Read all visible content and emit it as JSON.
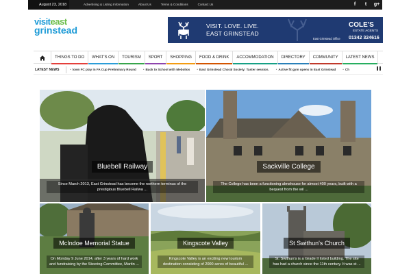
{
  "topbar": {
    "date": "August 23, 2018",
    "links": [
      "Advertising & Listing Information",
      "About Us",
      "Terms & Conditions",
      "Contact Us"
    ],
    "social": [
      {
        "icon": "facebook-icon",
        "glyph": "f"
      },
      {
        "icon": "twitter-icon",
        "glyph": "t"
      },
      {
        "icon": "googleplus-icon",
        "glyph": "g+"
      }
    ]
  },
  "logo": {
    "line1a": "visit",
    "line1b": "east",
    "line2": "grinstead"
  },
  "ad": {
    "line1": "VISIT.   LOVE.   LIVE.",
    "line2": "EAST GRINSTEAD",
    "brand": "COLE'S",
    "brand_sub": "ESTATE AGENTS",
    "office": "East Grinstead Office",
    "phone": "01342 324616"
  },
  "nav": {
    "home_icon": "home-icon",
    "items": [
      {
        "label": "THINGS TO DO",
        "color": "#e43f3b"
      },
      {
        "label": "WHAT'S ON",
        "color": "#2b9dd8"
      },
      {
        "label": "TOURISM",
        "color": "#37a54b"
      },
      {
        "label": "SPORT",
        "color": "#8e44ad"
      },
      {
        "label": "SHOPPING",
        "color": "#f39c12"
      },
      {
        "label": "FOOD & DRINK",
        "color": "#d35400"
      },
      {
        "label": "ACCOMMODATION",
        "color": "#16a085"
      },
      {
        "label": "DIRECTORY",
        "color": "#2980b9"
      },
      {
        "label": "COMMUNITY",
        "color": "#c0392b"
      },
      {
        "label": "LATEST NEWS",
        "color": "#27ae60"
      }
    ]
  },
  "ticker": {
    "label": "LATEST NEWS",
    "items": [
      "town FC play in FA Cup Preliminary Round",
      "Back to School with Mebolios",
      "East Grinstead Choral Society: Taster session.",
      "Active fit gym opens in East Grinstead",
      "Ch"
    ],
    "control_icon": "pause-icon"
  },
  "tiles": [
    {
      "title": "Bluebell Railway",
      "desc": "Since March 2013, East Grinstead has become the northern terminus of the prestigious Bluebell Railwa ..."
    },
    {
      "title": "Sackville College",
      "desc": "The College has been a functioning almshouse for almost 400 years, built with a bequest from the wil ..."
    },
    {
      "title": "McIndoe Memorial Statue",
      "desc": "On Monday 9 June 2014, after 3 years of hard work and fundraising by the Steering Committee, Martin ..."
    },
    {
      "title": "Kingscote Valley",
      "desc": "Kingscote Valley is an exciting new tourism destination consisting of 2000 acres of beautiful ..."
    },
    {
      "title": "St Swithun's Church",
      "desc": "St. Swithun's is a Grade II listed building. The site has had a church since the 11th century. It was st ..."
    }
  ]
}
